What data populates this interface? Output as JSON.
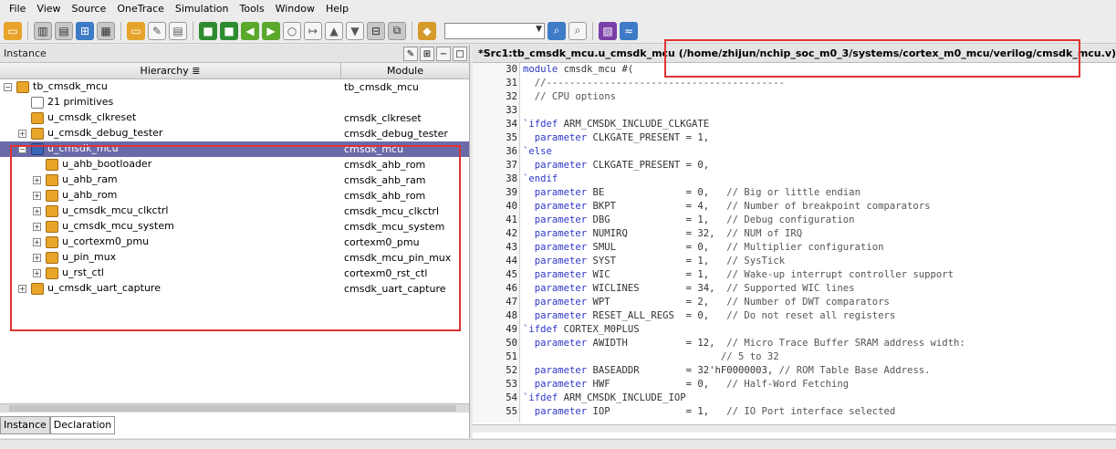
{
  "menu": [
    "File",
    "View",
    "Source",
    "OneTrace",
    "Simulation",
    "Tools",
    "Window",
    "Help"
  ],
  "toolbar_icons": [
    "open-folder-icon",
    "schematic-icon",
    "debug-icon",
    "tree-icon",
    "grid-icon",
    "folder-icon",
    "edit-icon",
    "doc-icon",
    "green-square-icon",
    "green-square2-icon",
    "green-arrow-left-icon",
    "green-arrow-right-icon",
    "circle-icon",
    "step-icon",
    "up-icon",
    "down-icon",
    "hier-icon",
    "copy-icon",
    "orange-icon",
    "search-icon",
    "find-icon",
    "purple-icon",
    "sim-icon"
  ],
  "search_combo_value": "",
  "left": {
    "panel_title": "Instance",
    "col_hierarchy": "Hierarchy",
    "col_module": "Module",
    "rows": [
      {
        "name": "tb_cmsdk_mcu",
        "module": "tb_cmsdk_mcu",
        "indent": 0,
        "icon": "fold",
        "exp": "−"
      },
      {
        "name": "21 primitives",
        "module": "",
        "indent": 1,
        "icon": "doc",
        "exp": ""
      },
      {
        "name": "u_cmsdk_clkreset",
        "module": "cmsdk_clkreset",
        "indent": 1,
        "icon": "fold",
        "exp": ""
      },
      {
        "name": "u_cmsdk_debug_tester",
        "module": "cmsdk_debug_tester",
        "indent": 1,
        "icon": "fold",
        "exp": "+"
      },
      {
        "name": "u_cmsdk_mcu",
        "module": "cmsdk_mcu",
        "indent": 1,
        "icon": "chip",
        "exp": "−",
        "sel": true
      },
      {
        "name": "u_ahb_bootloader",
        "module": "cmsdk_ahb_rom",
        "indent": 2,
        "icon": "fold",
        "exp": ""
      },
      {
        "name": "u_ahb_ram",
        "module": "cmsdk_ahb_ram",
        "indent": 2,
        "icon": "fold",
        "exp": "+"
      },
      {
        "name": "u_ahb_rom",
        "module": "cmsdk_ahb_rom",
        "indent": 2,
        "icon": "fold",
        "exp": "+"
      },
      {
        "name": "u_cmsdk_mcu_clkctrl",
        "module": "cmsdk_mcu_clkctrl",
        "indent": 2,
        "icon": "fold",
        "exp": "+"
      },
      {
        "name": "u_cmsdk_mcu_system",
        "module": "cmsdk_mcu_system",
        "indent": 2,
        "icon": "fold",
        "exp": "+"
      },
      {
        "name": "u_cortexm0_pmu",
        "module": "cortexm0_pmu",
        "indent": 2,
        "icon": "fold",
        "exp": "+"
      },
      {
        "name": "u_pin_mux",
        "module": "cmsdk_mcu_pin_mux",
        "indent": 2,
        "icon": "fold",
        "exp": "+"
      },
      {
        "name": "u_rst_ctl",
        "module": "cortexm0_rst_ctl",
        "indent": 2,
        "icon": "fold",
        "exp": "+"
      },
      {
        "name": "u_cmsdk_uart_capture",
        "module": "cmsdk_uart_capture",
        "indent": 1,
        "icon": "fold",
        "exp": "+"
      }
    ],
    "tabs": [
      "Instance",
      "Declaration"
    ]
  },
  "right": {
    "path_prefix": "*Src1:tb_cmsdk_mcu.u_cmsdk_mcu (",
    "path": "/home/zhijun/nchip_soc_m0_3/systems/cortex_m0_mcu/verilog/cmsdk_mcu.v)",
    "lines": [
      {
        "n": "30",
        "t": "module cmsdk_mcu #("
      },
      {
        "n": "31",
        "t": "  //-----------------------------------------"
      },
      {
        "n": "32",
        "t": "  // CPU options"
      },
      {
        "n": "33",
        "t": ""
      },
      {
        "n": "34",
        "t": "`ifdef ARM_CMSDK_INCLUDE_CLKGATE"
      },
      {
        "n": "35",
        "t": "  parameter CLKGATE_PRESENT = 1,"
      },
      {
        "n": "36",
        "t": "`else"
      },
      {
        "n": "37",
        "t": "  parameter CLKGATE_PRESENT = 0,"
      },
      {
        "n": "38",
        "t": "`endif"
      },
      {
        "n": "39",
        "t": "  parameter BE              = 0,   // Big or little endian"
      },
      {
        "n": "40",
        "t": "  parameter BKPT            = 4,   // Number of breakpoint comparators"
      },
      {
        "n": "41",
        "t": "  parameter DBG             = 1,   // Debug configuration"
      },
      {
        "n": "42",
        "t": "  parameter NUMIRQ          = 32,  // NUM of IRQ"
      },
      {
        "n": "43",
        "t": "  parameter SMUL            = 0,   // Multiplier configuration"
      },
      {
        "n": "44",
        "t": "  parameter SYST            = 1,   // SysTick"
      },
      {
        "n": "45",
        "t": "  parameter WIC             = 1,   // Wake-up interrupt controller support"
      },
      {
        "n": "46",
        "t": "  parameter WICLINES        = 34,  // Supported WIC lines"
      },
      {
        "n": "47",
        "t": "  parameter WPT             = 2,   // Number of DWT comparators"
      },
      {
        "n": "48",
        "t": "  parameter RESET_ALL_REGS  = 0,   // Do not reset all registers"
      },
      {
        "n": "49",
        "t": "`ifdef CORTEX_M0PLUS"
      },
      {
        "n": "50",
        "t": "  parameter AWIDTH          = 12,  // Micro Trace Buffer SRAM address width:"
      },
      {
        "n": "51",
        "t": "                                  // 5 to 32"
      },
      {
        "n": "52",
        "t": "  parameter BASEADDR        = 32'hF0000003, // ROM Table Base Address."
      },
      {
        "n": "53",
        "t": "  parameter HWF             = 0,   // Half-Word Fetching"
      },
      {
        "n": "54",
        "t": "`ifdef ARM_CMSDK_INCLUDE_IOP"
      },
      {
        "n": "55",
        "t": "  parameter IOP             = 1,   // IO Port interface selected"
      }
    ]
  },
  "colors": {
    "selection": "#6b6aa9",
    "highlight_box": "#e03232",
    "keyword": "#2d37c9"
  }
}
